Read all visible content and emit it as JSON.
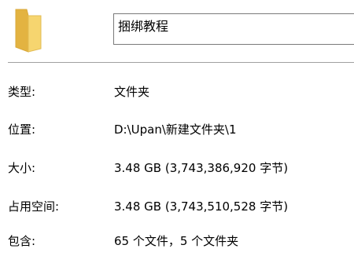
{
  "folder": {
    "icon": "folder-icon",
    "icon_color": "#f3cf6a",
    "name_value": "捆绑教程"
  },
  "properties": [
    {
      "label": "类型:",
      "value": "文件夹"
    },
    {
      "label": "位置:",
      "value": "D:\\Upan\\新建文件夹\\1"
    },
    {
      "label": "大小:",
      "value": "3.48 GB (3,743,386,920 字节)"
    },
    {
      "label": "占用空间:",
      "value": "3.48 GB (3,743,510,528 字节)"
    },
    {
      "label": "包含:",
      "value": "65 个文件，5 个文件夹"
    }
  ]
}
